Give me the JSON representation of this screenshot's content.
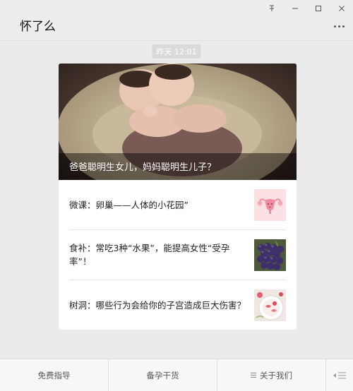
{
  "window": {
    "controls": [
      "pin-icon",
      "minimize-icon",
      "maximize-icon",
      "close-icon"
    ]
  },
  "chat": {
    "title": "怀了么",
    "timestamp": "昨天 12:01"
  },
  "article": {
    "cover_title": "爸爸聪明生女儿，妈妈聪明生儿子？",
    "items": [
      {
        "title": "微课：卵巢——人体的小花园”",
        "thumb_icon": "ovary-illustration-icon"
      },
      {
        "title": "食补：常吃3种“水果”，能提高女性“受孕率”！",
        "thumb_icon": "grapes-photo-icon"
      },
      {
        "title": "树洞：哪些行为会给你的子宫造成巨大伤害？",
        "thumb_icon": "food-plate-photo-icon"
      }
    ]
  },
  "footer": {
    "menu1": "免费指导",
    "menu2": "备孕干货",
    "menu3": "关于我们"
  },
  "colors": {
    "background": "#ebebeb",
    "card": "#ffffff",
    "text": "#222222"
  }
}
